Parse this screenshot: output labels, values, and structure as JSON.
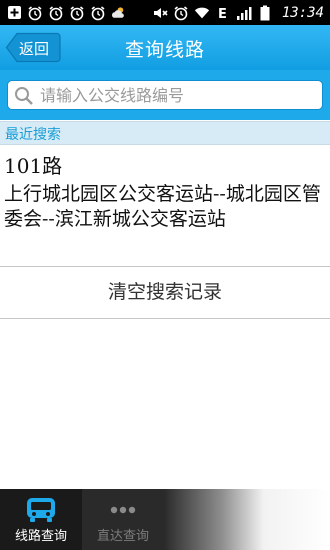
{
  "status_bar": {
    "time": "13:34",
    "icons": [
      "plus-box-icon",
      "alarm-clock-icon",
      "alarm-clock-icon",
      "alarm-clock-icon",
      "alarm-clock-icon",
      "weather-cloud-icon",
      "mute-icon",
      "alarm-clock-icon",
      "wifi-icon",
      "edge-signal-icon",
      "signal-bars-icon",
      "battery-icon"
    ],
    "network_label": "E"
  },
  "header": {
    "back_label": "返回",
    "title": "查询线路"
  },
  "search": {
    "placeholder": "请输入公交线路编号"
  },
  "recent": {
    "header_label": "最近搜索",
    "items": [
      {
        "route": "101路",
        "description": "上行城北园区公交客运站--城北园区管委会--滨江新城公交客运站"
      }
    ],
    "clear_label": "清空搜索记录"
  },
  "bottom_nav": {
    "tabs": [
      {
        "label": "线路查询",
        "icon": "bus-icon",
        "active": true
      },
      {
        "label": "直达查询",
        "icon": "more-dots-icon",
        "active": false
      }
    ]
  },
  "colors": {
    "accent": "#1ea9ea",
    "header_bg": "#d6ebf5",
    "nav_bg": "#2a2a2a"
  }
}
